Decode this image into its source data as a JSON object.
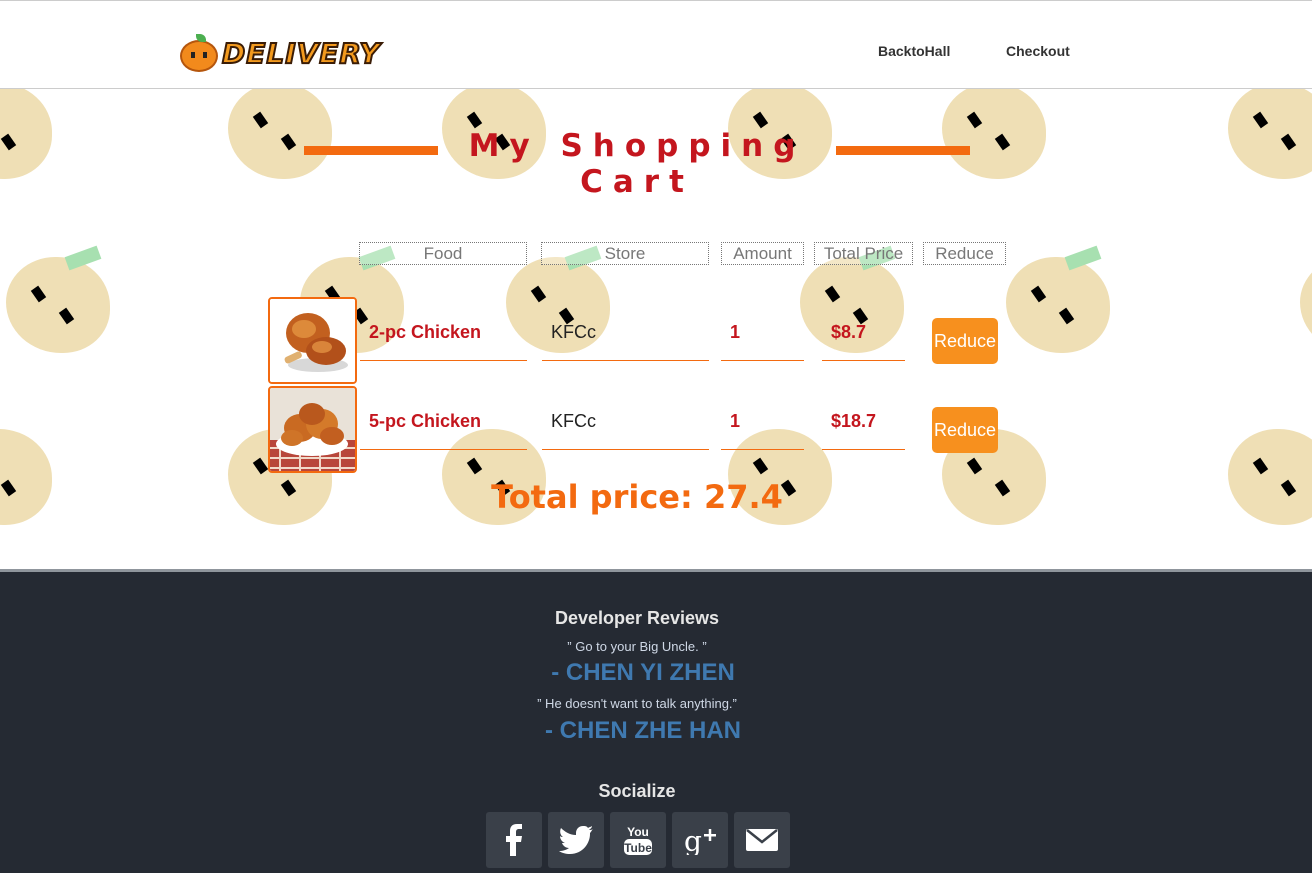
{
  "nav": {
    "logo_text": "DELIVERY",
    "links": [
      "BacktoHall",
      "Checkout"
    ]
  },
  "page_title": "My Shopping Cart",
  "table": {
    "headers": [
      "Food",
      "Store",
      "Amount",
      "Total Price",
      "Reduce"
    ],
    "rows": [
      {
        "food": "2-pc Chicken",
        "store": "KFCc",
        "amount": "1",
        "price": "$8.7",
        "action": "Reduce",
        "image": "fried-chicken-drumsticks"
      },
      {
        "food": "5-pc Chicken",
        "store": "KFCc",
        "amount": "1",
        "price": "$18.7",
        "action": "Reduce",
        "image": "fried-chicken-platter"
      }
    ]
  },
  "total_label": "Total price: 27.4",
  "footer": {
    "reviews_heading": "Developer Reviews",
    "quotes": [
      {
        "text": "” Go to your Big Uncle. ”",
        "author": "- CHEN YI ZHEN"
      },
      {
        "text": "” He doesn't want to talk anything.”",
        "author": "- CHEN ZHE HAN"
      }
    ],
    "socialize_heading": "Socialize",
    "social_icons": [
      "facebook-icon",
      "twitter-icon",
      "youtube-icon",
      "google-plus-icon",
      "mail-icon"
    ]
  },
  "colors": {
    "accent_orange": "#f36a10",
    "title_red": "#c4161e",
    "button_orange": "#f7901e",
    "footer_bg": "#252a33",
    "author_blue": "#3f79b0"
  }
}
